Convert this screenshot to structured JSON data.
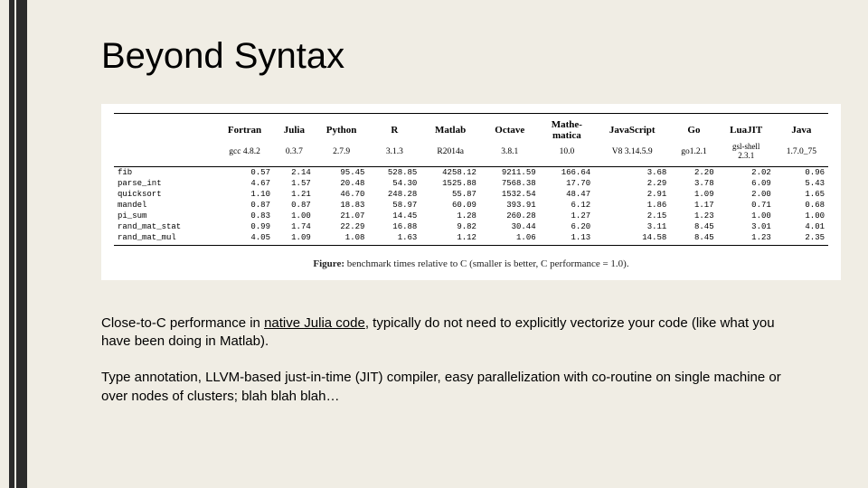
{
  "title": "Beyond Syntax",
  "chart_data": {
    "type": "table",
    "title": "benchmark times relative to C (smaller is better, C performance = 1.0).",
    "columns": [
      "Fortran",
      "Julia",
      "Python",
      "R",
      "Matlab",
      "Octave",
      "Mathematica",
      "JavaScript",
      "Go",
      "LuaJIT",
      "Java"
    ],
    "versions": [
      "gcc 4.8.2",
      "0.3.7",
      "2.7.9",
      "3.1.3",
      "R2014a",
      "3.8.1",
      "10.0",
      "V8 3.14.5.9",
      "go1.2.1",
      "gsl-shell 2.3.1",
      "1.7.0_75"
    ],
    "rows": [
      {
        "name": "fib",
        "values": [
          0.57,
          2.14,
          95.45,
          528.85,
          4258.12,
          9211.59,
          166.64,
          3.68,
          2.2,
          2.02,
          0.96
        ]
      },
      {
        "name": "parse_int",
        "values": [
          4.67,
          1.57,
          20.48,
          54.3,
          1525.88,
          7568.38,
          17.7,
          2.29,
          3.78,
          6.09,
          5.43
        ]
      },
      {
        "name": "quicksort",
        "values": [
          1.1,
          1.21,
          46.7,
          248.28,
          55.87,
          1532.54,
          48.47,
          2.91,
          1.09,
          2.0,
          1.65
        ]
      },
      {
        "name": "mandel",
        "values": [
          0.87,
          0.87,
          18.83,
          58.97,
          60.09,
          393.91,
          6.12,
          1.86,
          1.17,
          0.71,
          0.68
        ]
      },
      {
        "name": "pi_sum",
        "values": [
          0.83,
          1.0,
          21.07,
          14.45,
          1.28,
          260.28,
          1.27,
          2.15,
          1.23,
          1.0,
          1.0
        ]
      },
      {
        "name": "rand_mat_stat",
        "values": [
          0.99,
          1.74,
          22.29,
          16.88,
          9.82,
          30.44,
          6.2,
          3.11,
          8.45,
          3.01,
          4.01
        ]
      },
      {
        "name": "rand_mat_mul",
        "values": [
          4.05,
          1.09,
          1.08,
          1.63,
          1.12,
          1.06,
          1.13,
          14.58,
          8.45,
          1.23,
          2.35
        ]
      }
    ]
  },
  "caption_label": "Figure:",
  "caption": "benchmark times relative to C (smaller is better, C performance = 1.0).",
  "para1_pre": "Close-to-C performance in ",
  "para1_ul": "native Julia code",
  "para1_post": ", typically do not need to explicitly vectorize your code (like what you have been doing in Matlab).",
  "para2": "Type annotation, LLVM-based just-in-time (JIT) compiler, easy parallelization with co-routine on single machine or over nodes of clusters; blah blah blah…"
}
